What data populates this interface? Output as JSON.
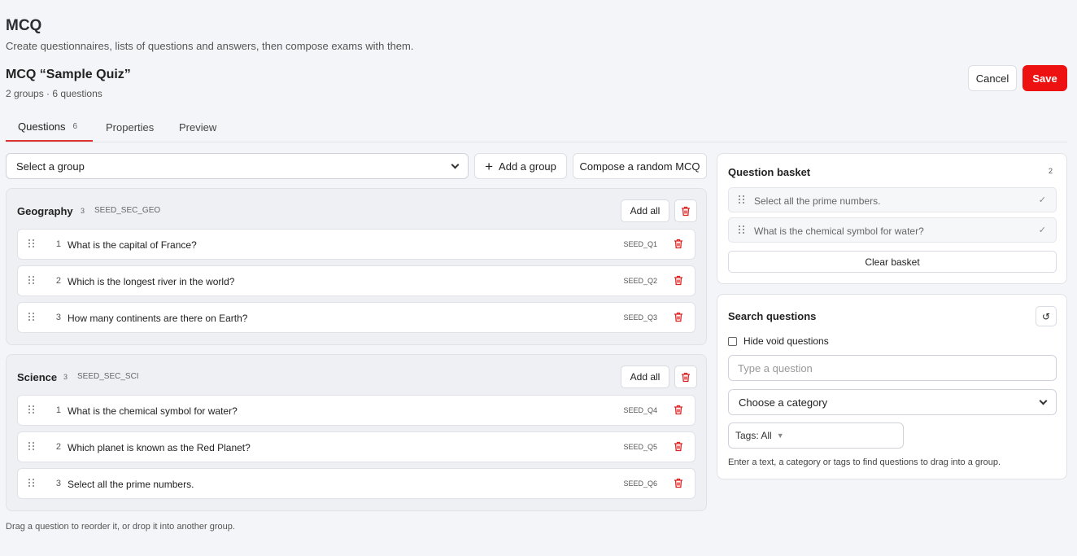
{
  "header": {
    "title": "MCQ",
    "subtitle": "Create questionnaires, lists of questions and answers, then compose exams with them.",
    "quiz_title": "MCQ “Sample Quiz”",
    "quiz_meta": "2 groups · 6 questions",
    "cancel_label": "Cancel",
    "save_label": "Save"
  },
  "tabs": [
    {
      "label": "Questions",
      "count": "6",
      "active": true
    },
    {
      "label": "Properties"
    },
    {
      "label": "Preview"
    }
  ],
  "toolbar": {
    "group_select": "Select a group",
    "add_group_label": "Add a group",
    "compose_label": "Compose a random MCQ"
  },
  "groups": [
    {
      "name": "Geography",
      "count": "3",
      "code": "SEED_SEC_GEO",
      "add_all_label": "Add all",
      "questions": [
        {
          "num": "1",
          "text": "What is the capital of France?",
          "code": "SEED_Q1"
        },
        {
          "num": "2",
          "text": "Which is the longest river in the world?",
          "code": "SEED_Q2"
        },
        {
          "num": "3",
          "text": "How many continents are there on Earth?",
          "code": "SEED_Q3"
        }
      ]
    },
    {
      "name": "Science",
      "count": "3",
      "code": "SEED_SEC_SCI",
      "add_all_label": "Add all",
      "questions": [
        {
          "num": "1",
          "text": "What is the chemical symbol for water?",
          "code": "SEED_Q4"
        },
        {
          "num": "2",
          "text": "Which planet is known as the Red Planet?",
          "code": "SEED_Q5"
        },
        {
          "num": "3",
          "text": "Select all the prime numbers.",
          "code": "SEED_Q6"
        }
      ]
    }
  ],
  "footer_hint": "Drag a question to reorder it, or drop it into another group.",
  "basket": {
    "title": "Question basket",
    "count": "2",
    "items": [
      {
        "text": "Select all the prime numbers.",
        "check": "✓"
      },
      {
        "text": "What is the chemical symbol for water?",
        "check": "✓"
      }
    ],
    "clear_label": "Clear basket"
  },
  "search": {
    "title": "Search questions",
    "reset_icon": "↺",
    "hide_void_label": "Hide void questions",
    "placeholder": "Type a question",
    "category_select": "Choose a category",
    "tags_label": "Tags: All",
    "hint": "Enter a text, a category or tags to find questions to drag into a group."
  },
  "colors": {
    "accent": "#ee1111",
    "tab_underline": "#dd3333",
    "delete": "#dd2222"
  }
}
